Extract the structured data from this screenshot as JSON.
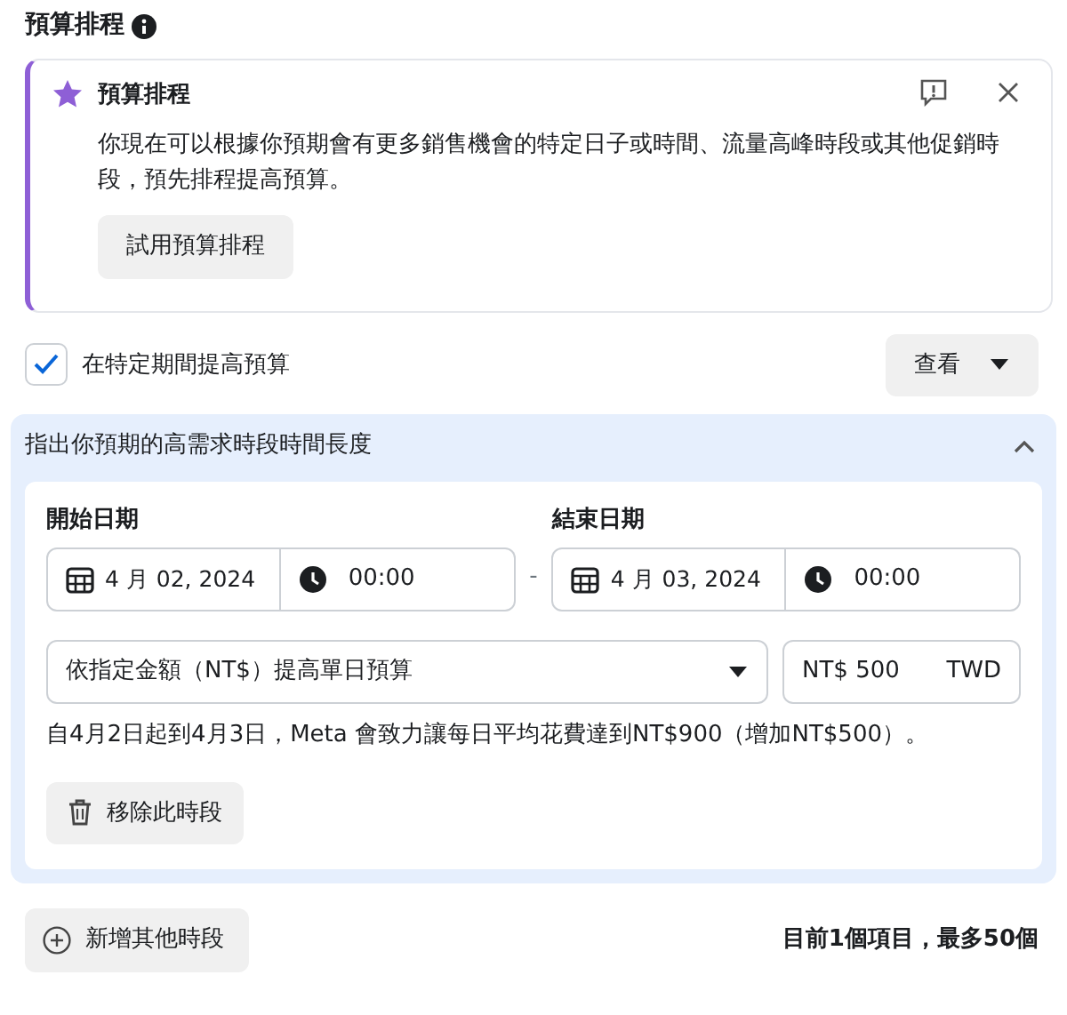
{
  "section_title": "預算排程",
  "notice": {
    "title": "預算排程",
    "body": "你現在可以根據你預期會有更多銷售機會的特定日子或時間、流量高峰時段或其他促銷時段，預先排程提高預算。",
    "button": "試用預算排程"
  },
  "toggle": {
    "label": "在特定期間提高預算",
    "checked": true
  },
  "view_button": "查看",
  "period": {
    "header": "指出你預期的高需求時段時間長度",
    "expanded": true,
    "start": {
      "label": "開始日期",
      "date": "4 月 02, 2024",
      "time": "00:00"
    },
    "separator": "-",
    "end": {
      "label": "結束日期",
      "date": "4 月 03, 2024",
      "time": "00:00"
    },
    "increase_type": "依指定金額（NT$）提高單日預算",
    "amount": "NT$ 500",
    "currency": "TWD",
    "summary": "自4月2日起到4月3日，Meta 會致力讓每日平均花費達到NT$900（增加NT$500）。",
    "remove_button": "移除此時段"
  },
  "add_button": "新增其他時段",
  "count_note": "目前1個項目，最多50個"
}
